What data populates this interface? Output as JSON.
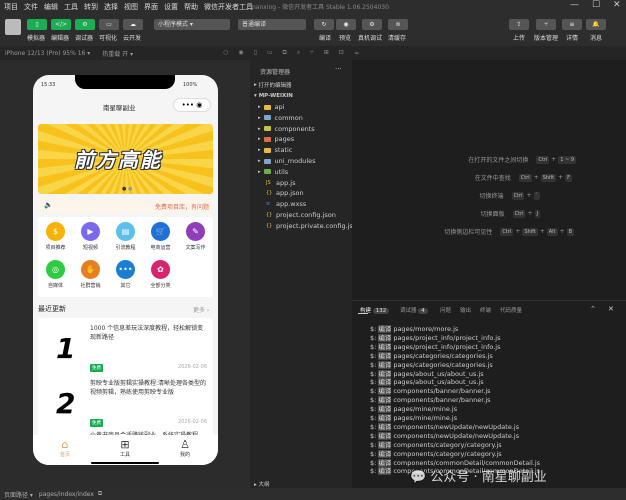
{
  "menu": [
    "项目",
    "文件",
    "编辑",
    "工具",
    "转到",
    "选择",
    "视图",
    "界面",
    "设置",
    "帮助",
    "微信开发者工具"
  ],
  "window_title": "nanxing - 微信开发者工具 Stable 1.06.2504030",
  "toolbar": {
    "simulator": "模拟器",
    "editor": "编辑器",
    "debugger": "调试器",
    "visual": "可视化",
    "cloud": "云开发",
    "mode": "小程序模式",
    "compile_mode": "普通编译",
    "compile": "编译",
    "preview": "预览",
    "real_debug": "真机调试",
    "clear_cache": "清缓存",
    "upload": "上传",
    "version": "版本管理",
    "details": "详情",
    "messages": "消息"
  },
  "subbar": {
    "device": "iPhone 12/13 (Pro) 95% 16 ▾",
    "hot_reload": "热重载 开 ▾"
  },
  "phone": {
    "time": "15:33",
    "battery": "100%",
    "title": "南星聊副业",
    "banner_text": "前方高能",
    "notice": "免费项目库，有问题",
    "categories": [
      {
        "label": "项目推荐",
        "color": "#f5b20a",
        "glyph": "$"
      },
      {
        "label": "短视频",
        "color": "#7b68ee",
        "glyph": "▶"
      },
      {
        "label": "引流教程",
        "color": "#5bc0eb",
        "glyph": "▤"
      },
      {
        "label": "电商运营",
        "color": "#1e6fd9",
        "glyph": "🛒"
      },
      {
        "label": "文案写作",
        "color": "#8e3fb8",
        "glyph": "✎"
      },
      {
        "label": "自媒体",
        "color": "#2ecc40",
        "glyph": "◎"
      },
      {
        "label": "社群营销",
        "color": "#e67e22",
        "glyph": "✋"
      },
      {
        "label": "其它",
        "color": "#1a7fd0",
        "glyph": "•••"
      },
      {
        "label": "全部分类",
        "color": "#d6246e",
        "glyph": "✿"
      }
    ],
    "recent_title": "最近更新",
    "more": "更多 ›",
    "articles": [
      {
        "num": "1",
        "title": "1000 个信息差玩法深度教程，轻松解锁变现新路径",
        "tag": "免费",
        "date": "2026-02-06"
      },
      {
        "num": "2",
        "title": "剪映专业版剪辑实操教程:清晰处理各类型的视频剪辑，熟练使用剪映专业版",
        "tag": "免费",
        "date": "2026-02-06"
      },
      {
        "title": "小黄书商品合适赚钱副业，系统实操教程"
      }
    ],
    "tabs": [
      "首页",
      "工具",
      "我的"
    ]
  },
  "explorer": {
    "title": "资源管理器",
    "more": "···",
    "open_editors": "打开的编辑器",
    "project": "MP-WEIXIN",
    "folders": [
      {
        "name": "api",
        "color": "#e8b93c"
      },
      {
        "name": "common",
        "color": "#7ea6c9"
      },
      {
        "name": "components",
        "color": "#c4c43a"
      },
      {
        "name": "pages",
        "color": "#e06c4c"
      },
      {
        "name": "static",
        "color": "#e8b93c"
      },
      {
        "name": "uni_modules",
        "color": "#7ea6c9"
      },
      {
        "name": "utils",
        "color": "#6bb04a"
      }
    ],
    "files": [
      {
        "name": "app.js",
        "icon": "JS",
        "color": "#e8c43c"
      },
      {
        "name": "app.json",
        "icon": "{}",
        "color": "#e8c43c"
      },
      {
        "name": "app.wxss",
        "icon": "≡",
        "color": "#3c8ee8"
      },
      {
        "name": "project.config.json",
        "icon": "{}",
        "color": "#e8c43c"
      },
      {
        "name": "project.private.config.js...",
        "icon": "{}",
        "color": "#e8c43c"
      }
    ],
    "outline": "大纲"
  },
  "shortcuts": [
    {
      "label": "在打开的文件之间切换",
      "keys": [
        "Ctrl",
        "1 ~ 9"
      ]
    },
    {
      "label": "在文件中查找",
      "keys": [
        "Ctrl",
        "Shift",
        "F"
      ]
    },
    {
      "label": "切换终端",
      "keys": [
        "Ctrl",
        "`"
      ]
    },
    {
      "label": "切换面板",
      "keys": [
        "Ctrl",
        "J"
      ]
    },
    {
      "label": "切换侧边栏可见性",
      "keys": [
        "Ctrl",
        "Shift",
        "Alt",
        "B"
      ]
    }
  ],
  "console": {
    "tabs": [
      {
        "label": "构建",
        "count": "132"
      },
      {
        "label": "调试器",
        "count": "4"
      },
      {
        "label": "问题"
      },
      {
        "label": "输出"
      },
      {
        "label": "终端"
      },
      {
        "label": "代码质量"
      }
    ],
    "prefix": "$:",
    "verb": "编译",
    "lines": [
      "pages/more/more.js",
      "pages/project_info/project_info.js",
      "pages/project_info/project_info.js",
      "pages/categories/categories.js",
      "pages/categories/categories.js",
      "pages/about_us/about_us.js",
      "pages/about_us/about_us.js",
      "components/banner/banner.js",
      "components/banner/banner.js",
      "pages/mine/mine.js",
      "pages/mine/mine.js",
      "components/newUpdate/newUpdate.js",
      "components/newUpdate/newUpdate.js",
      "components/category/category.js",
      "components/category/category.js",
      "components/commonDetail/commonDetail.js",
      "components/commonDetail/commonDetail.js"
    ]
  },
  "status": {
    "path_label": "页面路径 ▾",
    "path": "pages/index/index"
  },
  "watermark": "公众号 · 南星聊副业"
}
